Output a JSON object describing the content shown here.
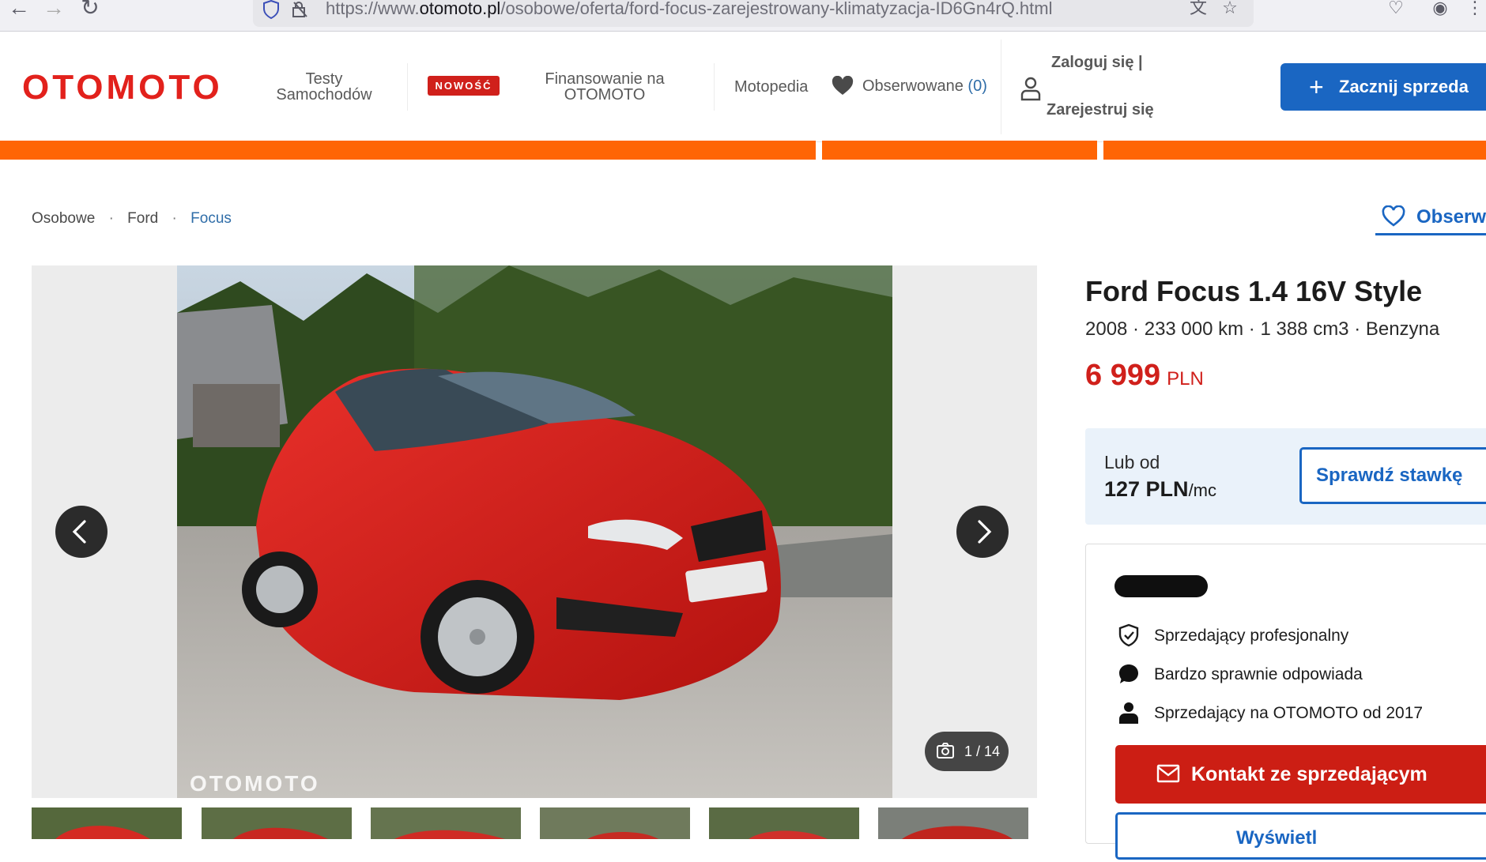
{
  "browser": {
    "url_prefix": "https://www.",
    "url_host": "otomoto.pl",
    "url_path": "/osobowe/oferta/ford-focus-zarejestrowany-klimatyzacja-ID6Gn4rQ.html"
  },
  "header": {
    "logo": "OTOMOTO",
    "nav": {
      "tests_line1": "Testy",
      "tests_line2": "Samochodów",
      "new_badge": "NOWOŚĆ",
      "finance_line1": "Finansowanie na",
      "finance_line2": "OTOMOTO",
      "motopedia": "Motopedia",
      "observed": "Obserwowane",
      "observed_count": "(0)"
    },
    "login": "Zaloguj się |",
    "register": "Zarejestruj się",
    "sell_button": "Zacznij sprzeda"
  },
  "breadcrumb": {
    "items": [
      "Osobowe",
      "Ford",
      "Focus"
    ],
    "separator": "·"
  },
  "observe_button": "Obserw",
  "gallery": {
    "watermark": "OTOMOTO",
    "counter": "1 / 14"
  },
  "listing": {
    "title": "Ford Focus 1.4 16V Style",
    "specs": "2008 · 233 000 km · 1 388 cm3 · Benzyna",
    "price": "6 999",
    "currency": "PLN",
    "finance_label": "Lub od",
    "finance_rate": "127 PLN",
    "finance_unit": "/mc",
    "check_rate_button": "Sprawdź stawkę"
  },
  "seller": {
    "features": [
      "Sprzedający profesjonalny",
      "Bardzo sprawnie odpowiada",
      "Sprzedający na OTOMOTO od 2017"
    ],
    "contact_button": "Kontakt ze sprzedającym",
    "second_button": "Wyświetl"
  },
  "colors": {
    "brand_red": "#d0201b",
    "primary_blue": "#1a66c2",
    "banner_orange": "#ff6505"
  }
}
